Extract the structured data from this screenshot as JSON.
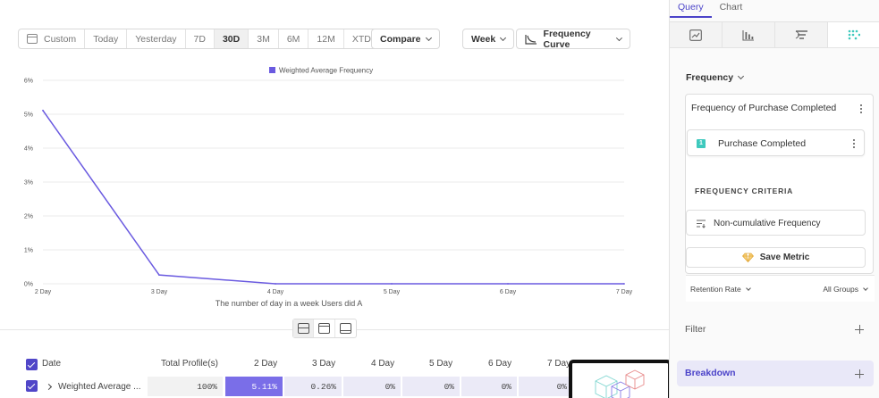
{
  "toolbar": {
    "custom": "Custom",
    "today": "Today",
    "yesterday": "Yesterday",
    "d7": "7D",
    "d30": "30D",
    "m3": "3M",
    "m6": "6M",
    "m12": "12M",
    "xtd": "XTD",
    "compare": "Compare",
    "interval": "Week",
    "chart_type": "Frequency Curve"
  },
  "chart_data": {
    "type": "line",
    "legend": [
      "Weighted Average Frequency"
    ],
    "x": [
      "2 Day",
      "3 Day",
      "4 Day",
      "5 Day",
      "6 Day",
      "7 Day"
    ],
    "series": [
      {
        "name": "Weighted Average Frequency",
        "values": [
          5.11,
          0.26,
          0,
          0,
          0,
          0
        ]
      }
    ],
    "y_ticks": [
      "0%",
      "1%",
      "2%",
      "3%",
      "4%",
      "5%",
      "6%"
    ],
    "ylim": [
      0,
      6
    ],
    "xlabel": "The number of day in a week Users did A",
    "ylabel": "",
    "grid": true,
    "legend_position": "top-center",
    "line_color": "#6a5ae0"
  },
  "table": {
    "headers": {
      "date": "Date",
      "total": "Total Profile(s)",
      "d2": "2 Day",
      "d3": "3 Day",
      "d4": "4 Day",
      "d5": "5 Day",
      "d6": "6 Day",
      "d7": "7 Day"
    },
    "row": {
      "label": "Weighted Average ...",
      "total": "100%",
      "d2": "5.11%",
      "d3": "0.26%",
      "d4": "0%",
      "d5": "0%",
      "d6": "0%",
      "d7": "0%"
    }
  },
  "side": {
    "tabs": {
      "query": "Query",
      "chart": "Chart"
    },
    "section": "Frequency",
    "metric_name": "Frequency of Purchase Completed",
    "event_index": "1",
    "event_name": "Purchase Completed",
    "criteria_title": "FREQUENCY CRITERIA",
    "criteria_value": "Non-cumulative Frequency",
    "save_metric": "Save Metric",
    "retention": "Retention Rate",
    "groups": "All Groups",
    "filter": "Filter",
    "breakdown": "Breakdown"
  },
  "colors": {
    "accent": "#4b43c9",
    "line": "#6a5ae0",
    "badge": "#3ec9bd"
  }
}
